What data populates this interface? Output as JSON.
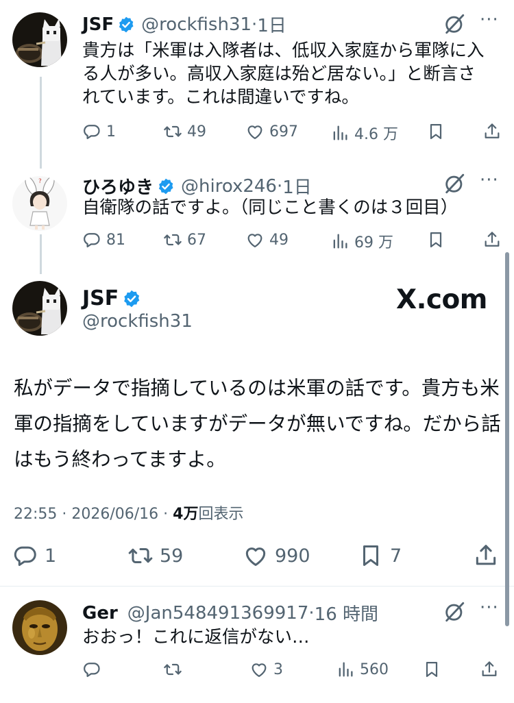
{
  "thread": [
    {
      "name": "JSF",
      "handle": "@rockfish31",
      "time": "1日",
      "text": "貴方は「米軍は入隊者は、低収入家庭から軍隊に入る人が多い。高収入家庭は殆ど居ない。」と断言されています。これは間違いですね。",
      "replies": "1",
      "reposts": "49",
      "likes": "697",
      "views": "4.6 万",
      "avatar": "cat-figure-avatar"
    },
    {
      "name": "ひろゆき",
      "handle": "@hirox246",
      "time": "1日",
      "text": "自衛隊の話ですよ。（同じこと書くのは３回目）",
      "replies": "81",
      "reposts": "67",
      "likes": "49",
      "views": "69 万",
      "avatar": "bunny-character-avatar"
    }
  ],
  "main_tweet": {
    "name": "JSF",
    "handle": "@rockfish31",
    "brand": "X.com",
    "text": "私がデータで指摘しているのは米軍の話です。貴方も米軍の指摘をしていますがデータが無いですね。だから話はもう終わってますよ。",
    "time": "22:55 · 2026/06/16 · ",
    "views_count": "4万",
    "views_label": "回表示",
    "replies": "1",
    "reposts": "59",
    "likes": "990",
    "bookmarks": "7"
  },
  "reply": {
    "name": "Ger",
    "handle": "@Jan548491369917",
    "time": "16 時間",
    "text": "おおっ！これに返信がない…",
    "replies": "",
    "reposts": "",
    "likes": "3",
    "views": "560",
    "avatar": "golden-mask-avatar"
  },
  "icons": {
    "verified": "verified-badge-icon",
    "grok": "grok-icon",
    "more": "more-icon",
    "reply": "reply-icon",
    "repost": "repost-icon",
    "like": "like-icon",
    "views": "views-icon",
    "bookmark": "bookmark-icon",
    "share": "share-icon"
  },
  "colors": {
    "text": "#0f1419",
    "secondary": "#536471",
    "verified": "#1d9bf0",
    "thread_line": "#cfd9de"
  }
}
